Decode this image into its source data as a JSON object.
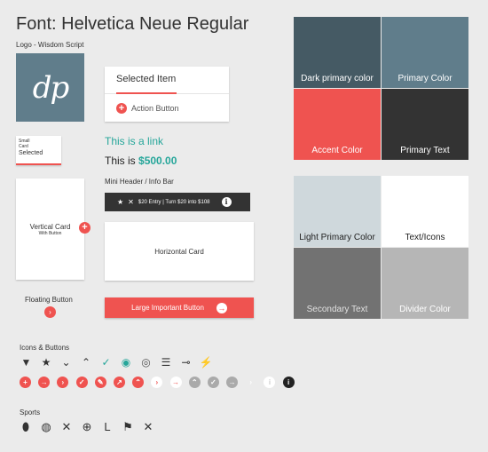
{
  "title": "Font: Helvetica Neue Regular",
  "logo": {
    "label": "Logo - Wisdom Script",
    "text": "dp"
  },
  "selected_card": {
    "item": "Selected Item",
    "action": "Action Button"
  },
  "small_card": {
    "line1": "Small",
    "line2": "Card",
    "selected": "Selected"
  },
  "link": "This is a link",
  "price": {
    "prefix": "This is ",
    "amount": "$500.00"
  },
  "mini_header": {
    "label": "Mini Header / Info Bar",
    "text": "$20 Entry | Turn $20 into $108"
  },
  "vertical_card": {
    "title": "Vertical Card",
    "subtitle": "With Button"
  },
  "horizontal_card": {
    "title": "Horizontal Card"
  },
  "floating_button": {
    "label": "Floating Button"
  },
  "large_button": {
    "label": "Large Important Button"
  },
  "swatches_top": [
    {
      "label": "Dark primary color",
      "bg": "#455a64",
      "fg": "#ffffff"
    },
    {
      "label": "Primary Color",
      "bg": "#607d8b",
      "fg": "#ffffff"
    },
    {
      "label": "Accent Color",
      "bg": "#ef5350",
      "fg": "#ffffff"
    },
    {
      "label": "Primary Text",
      "bg": "#333333",
      "fg": "#ffffff"
    }
  ],
  "swatches_bottom": [
    {
      "label": "Light Primary Color",
      "bg": "#cfd8dc",
      "fg": "#222222"
    },
    {
      "label": "Text/Icons",
      "bg": "#ffffff",
      "fg": "#222222"
    },
    {
      "label": "Secondary Text",
      "bg": "#727272",
      "fg": "#e0e0e0"
    },
    {
      "label": "Divider Color",
      "bg": "#b6b6b6",
      "fg": "#ffffff"
    }
  ],
  "icons_label": "Icons & Buttons",
  "icons_row1": [
    {
      "name": "filter-icon",
      "glyph": "▼",
      "color": "#333333"
    },
    {
      "name": "star-down-icon",
      "glyph": "★",
      "color": "#333333"
    },
    {
      "name": "chevron-down-icon",
      "glyph": "⌄",
      "color": "#333333"
    },
    {
      "name": "chevron-up-icon",
      "glyph": "⌃",
      "color": "#333333"
    },
    {
      "name": "check-icon",
      "glyph": "✓",
      "color": "#26a69a"
    },
    {
      "name": "rss-filled-icon",
      "glyph": "◉",
      "color": "#26a69a"
    },
    {
      "name": "rss-outline-icon",
      "glyph": "◎",
      "color": "#555555"
    },
    {
      "name": "sort-lines-icon",
      "glyph": "☰",
      "color": "#333333"
    },
    {
      "name": "key-icon",
      "glyph": "⊸",
      "color": "#333333"
    },
    {
      "name": "lightning-icon",
      "glyph": "⚡",
      "color": "#ef5350"
    }
  ],
  "icons_row2": [
    {
      "name": "plus-circle-icon",
      "glyph": "+",
      "bg": "#ef5350",
      "fg": "#ffffff"
    },
    {
      "name": "arrow-right-circle-icon",
      "glyph": "→",
      "bg": "#ef5350",
      "fg": "#ffffff"
    },
    {
      "name": "chevron-right-circle-icon",
      "glyph": "›",
      "bg": "#ef5350",
      "fg": "#ffffff"
    },
    {
      "name": "check-circle-icon",
      "glyph": "✓",
      "bg": "#ef5350",
      "fg": "#ffffff"
    },
    {
      "name": "edit-circle-icon",
      "glyph": "✎",
      "bg": "#ef5350",
      "fg": "#ffffff"
    },
    {
      "name": "arrow-upright-circle-icon",
      "glyph": "↗",
      "bg": "#ef5350",
      "fg": "#ffffff"
    },
    {
      "name": "chevron-up-circle-icon",
      "glyph": "⌃",
      "bg": "#ef5350",
      "fg": "#ffffff"
    },
    {
      "name": "chevron-right-white-icon",
      "glyph": "›",
      "bg": "#ffffff",
      "fg": "#ef5350"
    },
    {
      "name": "arrow-right-white-icon",
      "glyph": "→",
      "bg": "#ffffff",
      "fg": "#ef5350"
    },
    {
      "name": "chevron-up-grey-icon",
      "glyph": "⌃",
      "bg": "#aaaaaa",
      "fg": "#ffffff"
    },
    {
      "name": "check-grey-icon",
      "glyph": "✓",
      "bg": "#aaaaaa",
      "fg": "#ffffff"
    },
    {
      "name": "arrow-right-grey-icon",
      "glyph": "→",
      "bg": "#aaaaaa",
      "fg": "#ffffff"
    },
    {
      "name": "chevron-right-plain-icon",
      "glyph": "›",
      "bg": "transparent",
      "fg": "#ffffff"
    },
    {
      "name": "info-white-icon",
      "glyph": "i",
      "bg": "#ffffff",
      "fg": "#cccccc"
    },
    {
      "name": "info-dark-icon",
      "glyph": "i",
      "bg": "#222222",
      "fg": "#ffffff"
    }
  ],
  "sports_label": "Sports",
  "sports": [
    {
      "name": "football-icon",
      "glyph": "⬮"
    },
    {
      "name": "baseball-icon",
      "glyph": "◍"
    },
    {
      "name": "hockey-icon",
      "glyph": "✕"
    },
    {
      "name": "basketball-icon",
      "glyph": "⊕"
    },
    {
      "name": "golf-icon",
      "glyph": "L"
    },
    {
      "name": "racing-flag-icon",
      "glyph": "⚑"
    },
    {
      "name": "hockey-sticks-icon",
      "glyph": "✕"
    }
  ]
}
